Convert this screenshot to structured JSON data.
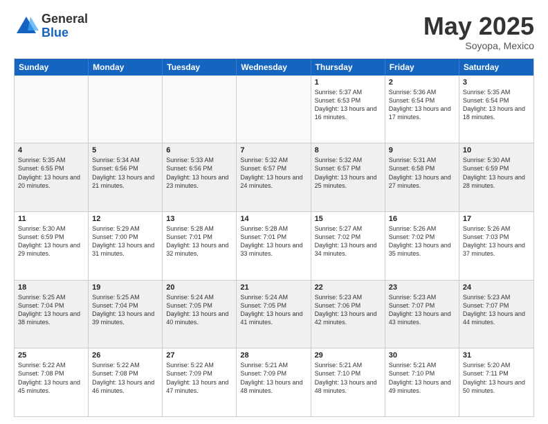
{
  "logo": {
    "general": "General",
    "blue": "Blue"
  },
  "title": "May 2025",
  "location": "Soyopa, Mexico",
  "days": [
    "Sunday",
    "Monday",
    "Tuesday",
    "Wednesday",
    "Thursday",
    "Friday",
    "Saturday"
  ],
  "rows": [
    [
      {
        "day": "",
        "empty": true
      },
      {
        "day": "",
        "empty": true
      },
      {
        "day": "",
        "empty": true
      },
      {
        "day": "",
        "empty": true
      },
      {
        "day": "1",
        "sunrise": "5:37 AM",
        "sunset": "6:53 PM",
        "daylight": "13 hours and 16 minutes."
      },
      {
        "day": "2",
        "sunrise": "5:36 AM",
        "sunset": "6:54 PM",
        "daylight": "13 hours and 17 minutes."
      },
      {
        "day": "3",
        "sunrise": "5:35 AM",
        "sunset": "6:54 PM",
        "daylight": "13 hours and 18 minutes."
      }
    ],
    [
      {
        "day": "4",
        "sunrise": "5:35 AM",
        "sunset": "6:55 PM",
        "daylight": "13 hours and 20 minutes."
      },
      {
        "day": "5",
        "sunrise": "5:34 AM",
        "sunset": "6:56 PM",
        "daylight": "13 hours and 21 minutes."
      },
      {
        "day": "6",
        "sunrise": "5:33 AM",
        "sunset": "6:56 PM",
        "daylight": "13 hours and 23 minutes."
      },
      {
        "day": "7",
        "sunrise": "5:32 AM",
        "sunset": "6:57 PM",
        "daylight": "13 hours and 24 minutes."
      },
      {
        "day": "8",
        "sunrise": "5:32 AM",
        "sunset": "6:57 PM",
        "daylight": "13 hours and 25 minutes."
      },
      {
        "day": "9",
        "sunrise": "5:31 AM",
        "sunset": "6:58 PM",
        "daylight": "13 hours and 27 minutes."
      },
      {
        "day": "10",
        "sunrise": "5:30 AM",
        "sunset": "6:59 PM",
        "daylight": "13 hours and 28 minutes."
      }
    ],
    [
      {
        "day": "11",
        "sunrise": "5:30 AM",
        "sunset": "6:59 PM",
        "daylight": "13 hours and 29 minutes."
      },
      {
        "day": "12",
        "sunrise": "5:29 AM",
        "sunset": "7:00 PM",
        "daylight": "13 hours and 31 minutes."
      },
      {
        "day": "13",
        "sunrise": "5:28 AM",
        "sunset": "7:01 PM",
        "daylight": "13 hours and 32 minutes."
      },
      {
        "day": "14",
        "sunrise": "5:28 AM",
        "sunset": "7:01 PM",
        "daylight": "13 hours and 33 minutes."
      },
      {
        "day": "15",
        "sunrise": "5:27 AM",
        "sunset": "7:02 PM",
        "daylight": "13 hours and 34 minutes."
      },
      {
        "day": "16",
        "sunrise": "5:26 AM",
        "sunset": "7:02 PM",
        "daylight": "13 hours and 35 minutes."
      },
      {
        "day": "17",
        "sunrise": "5:26 AM",
        "sunset": "7:03 PM",
        "daylight": "13 hours and 37 minutes."
      }
    ],
    [
      {
        "day": "18",
        "sunrise": "5:25 AM",
        "sunset": "7:04 PM",
        "daylight": "13 hours and 38 minutes."
      },
      {
        "day": "19",
        "sunrise": "5:25 AM",
        "sunset": "7:04 PM",
        "daylight": "13 hours and 39 minutes."
      },
      {
        "day": "20",
        "sunrise": "5:24 AM",
        "sunset": "7:05 PM",
        "daylight": "13 hours and 40 minutes."
      },
      {
        "day": "21",
        "sunrise": "5:24 AM",
        "sunset": "7:05 PM",
        "daylight": "13 hours and 41 minutes."
      },
      {
        "day": "22",
        "sunrise": "5:23 AM",
        "sunset": "7:06 PM",
        "daylight": "13 hours and 42 minutes."
      },
      {
        "day": "23",
        "sunrise": "5:23 AM",
        "sunset": "7:07 PM",
        "daylight": "13 hours and 43 minutes."
      },
      {
        "day": "24",
        "sunrise": "5:23 AM",
        "sunset": "7:07 PM",
        "daylight": "13 hours and 44 minutes."
      }
    ],
    [
      {
        "day": "25",
        "sunrise": "5:22 AM",
        "sunset": "7:08 PM",
        "daylight": "13 hours and 45 minutes."
      },
      {
        "day": "26",
        "sunrise": "5:22 AM",
        "sunset": "7:08 PM",
        "daylight": "13 hours and 46 minutes."
      },
      {
        "day": "27",
        "sunrise": "5:22 AM",
        "sunset": "7:09 PM",
        "daylight": "13 hours and 47 minutes."
      },
      {
        "day": "28",
        "sunrise": "5:21 AM",
        "sunset": "7:09 PM",
        "daylight": "13 hours and 48 minutes."
      },
      {
        "day": "29",
        "sunrise": "5:21 AM",
        "sunset": "7:10 PM",
        "daylight": "13 hours and 48 minutes."
      },
      {
        "day": "30",
        "sunrise": "5:21 AM",
        "sunset": "7:10 PM",
        "daylight": "13 hours and 49 minutes."
      },
      {
        "day": "31",
        "sunrise": "5:20 AM",
        "sunset": "7:11 PM",
        "daylight": "13 hours and 50 minutes."
      }
    ]
  ]
}
